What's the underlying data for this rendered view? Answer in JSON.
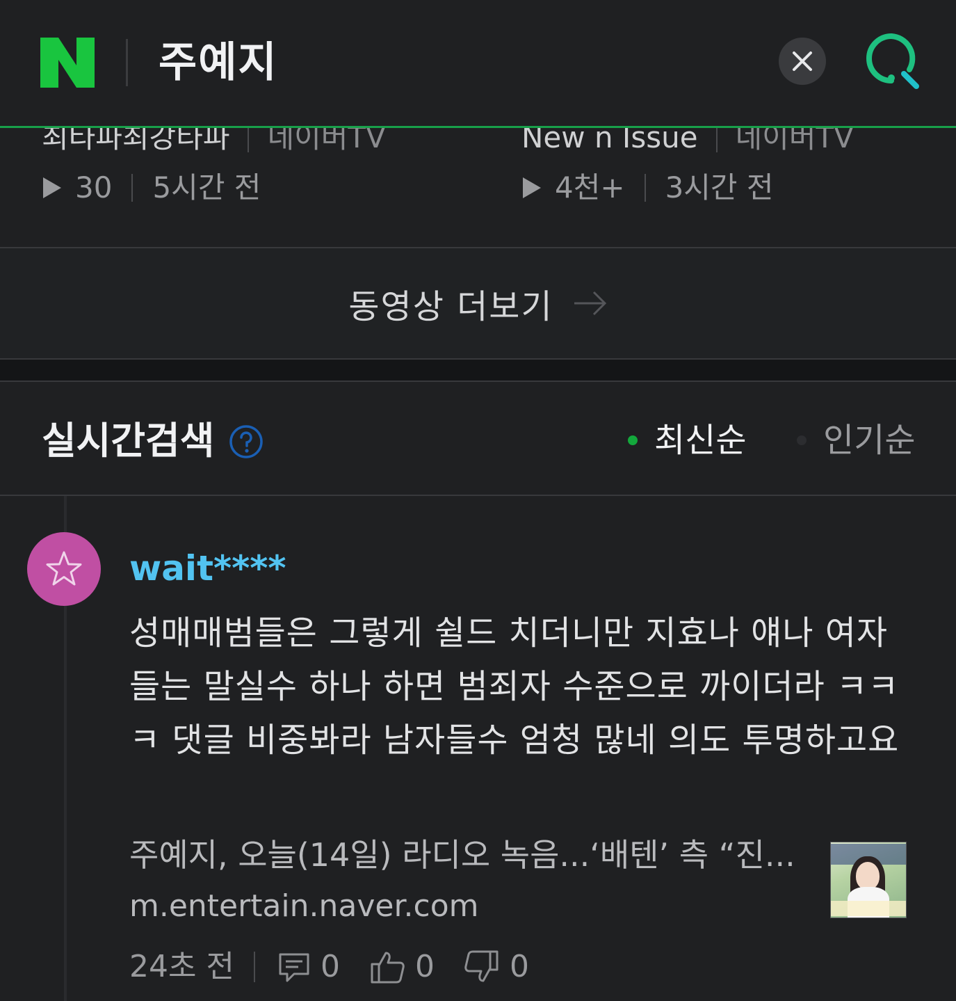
{
  "header": {
    "title": "주예지",
    "logo_letter": "N",
    "accent_color": "#18a04a",
    "close_icon": "close-icon",
    "search_icon": "search-icon"
  },
  "videos": [
    {
      "source": "최타파최강타파",
      "platform": "네이버TV",
      "views": "30",
      "time": "5시간 전"
    },
    {
      "source": "New n Issue",
      "platform": "네이버TV",
      "views": "4천+",
      "time": "3시간 전"
    }
  ],
  "more_videos": {
    "label": "동영상 더보기"
  },
  "realtime": {
    "title": "실시간검색",
    "sort_latest": "최신순",
    "sort_popular": "인기순",
    "active_dot_color": "#13a83c"
  },
  "comment": {
    "username": "wait****",
    "avatar_color": "#c04fa3",
    "text": "성매매범들은 그렇게 쉴드 치더니만 지효나 얘나 여자들는 말실수 하나 하면 범죄자 수준으로 까이더라 ㅋㅋㅋ 댓글 비중봐라 남자들수 엄청 많네 의도 투명하고요",
    "article_title": "주예지, 오늘(14일) 라디오 녹음...‘배텐’ 측 “진...",
    "article_url": "m.entertain.naver.com",
    "time": "24초 전",
    "replies": "0",
    "likes": "0",
    "dislikes": "0"
  }
}
